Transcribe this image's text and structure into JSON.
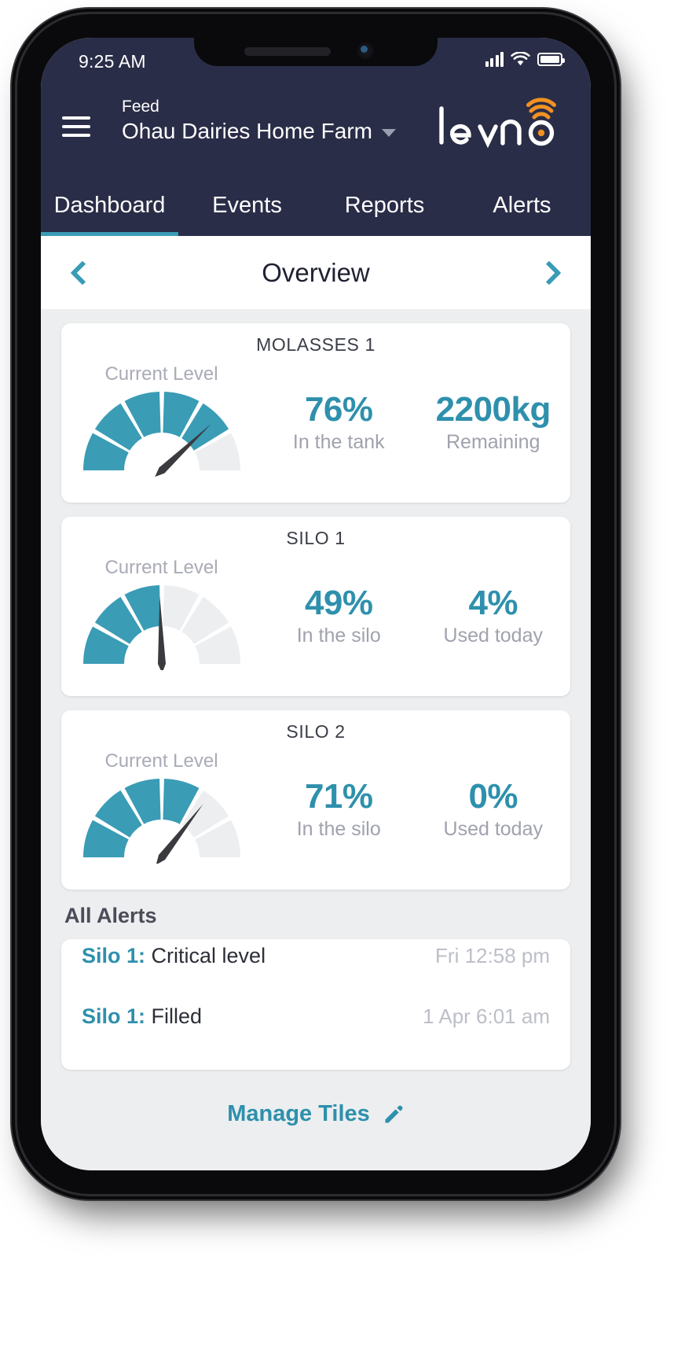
{
  "status_bar": {
    "time": "9:25 AM",
    "signal_icon": "cellular-signal-icon",
    "wifi_icon": "wifi-icon",
    "battery_icon": "battery-full-icon"
  },
  "header": {
    "menu_icon": "hamburger-menu-icon",
    "feed_label": "Feed",
    "farm_name": "Ohau Dairies Home Farm",
    "dropdown_icon": "chevron-down-icon",
    "logo_text": "levno",
    "logo_icon": "levno-wifi-logo-icon",
    "brand_navy": "#2a2d47",
    "brand_orange": "#f29222"
  },
  "tabs": [
    {
      "label": "Dashboard",
      "active": true
    },
    {
      "label": "Events",
      "active": false
    },
    {
      "label": "Reports",
      "active": false
    },
    {
      "label": "Alerts",
      "active": false
    }
  ],
  "overview_nav": {
    "prev_icon": "chevron-left-icon",
    "title": "Overview",
    "next_icon": "chevron-right-icon",
    "accent": "#3a9cb5"
  },
  "tiles": [
    {
      "title": "MOLASSES 1",
      "gauge_caption": "Current Level",
      "gauge_percent": 76,
      "stats": [
        {
          "value": "76%",
          "label": "In the tank"
        },
        {
          "value": "2200kg",
          "label": "Remaining"
        }
      ]
    },
    {
      "title": "SILO 1",
      "gauge_caption": "Current Level",
      "gauge_percent": 49,
      "stats": [
        {
          "value": "49%",
          "label": "In the silo"
        },
        {
          "value": "4%",
          "label": "Used today"
        }
      ]
    },
    {
      "title": "SILO 2",
      "gauge_caption": "Current Level",
      "gauge_percent": 71,
      "stats": [
        {
          "value": "71%",
          "label": "In the silo"
        },
        {
          "value": "0%",
          "label": "Used today"
        }
      ]
    }
  ],
  "alerts_section": {
    "heading": "All Alerts",
    "rows": [
      {
        "subject": "Silo 1:",
        "message": "Critical level",
        "time": "Fri 12:58 pm"
      },
      {
        "subject": "Silo 1:",
        "message": "Filled",
        "time": "1 Apr 6:01 am"
      }
    ]
  },
  "footer": {
    "manage_tiles_label": "Manage Tiles",
    "edit_icon": "pencil-icon"
  },
  "chart_data": [
    {
      "type": "gauge",
      "title": "MOLASSES 1 Current Level",
      "value": 76,
      "unit": "%",
      "range": [
        0,
        100
      ],
      "segments": 6,
      "filled_color": "#3a9cb5",
      "empty_color": "#eceef0"
    },
    {
      "type": "gauge",
      "title": "SILO 1 Current Level",
      "value": 49,
      "unit": "%",
      "range": [
        0,
        100
      ],
      "segments": 6,
      "filled_color": "#3a9cb5",
      "empty_color": "#eceef0"
    },
    {
      "type": "gauge",
      "title": "SILO 2 Current Level",
      "value": 71,
      "unit": "%",
      "range": [
        0,
        100
      ],
      "segments": 6,
      "filled_color": "#3a9cb5",
      "empty_color": "#eceef0"
    }
  ]
}
